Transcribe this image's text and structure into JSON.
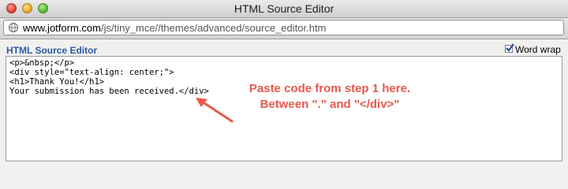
{
  "window": {
    "title": "HTML Source Editor",
    "url_host": "www.jotform.com",
    "url_path": "/js/tiny_mce//themes/advanced/source_editor.htm"
  },
  "editor_panel": {
    "heading": "HTML Source Editor",
    "word_wrap_label": "Word wrap",
    "word_wrap_checked": true,
    "code_lines": [
      "<p>&nbsp;</p>",
      "<div style=\"text-align: center;\">",
      "<h1>Thank You!</h1>",
      "Your submission has been received.</div>"
    ]
  },
  "annotation": {
    "line1": "Paste code from step 1 here.",
    "line2": "Between \".\" and \"</div>\"",
    "color": "#e8584a"
  }
}
